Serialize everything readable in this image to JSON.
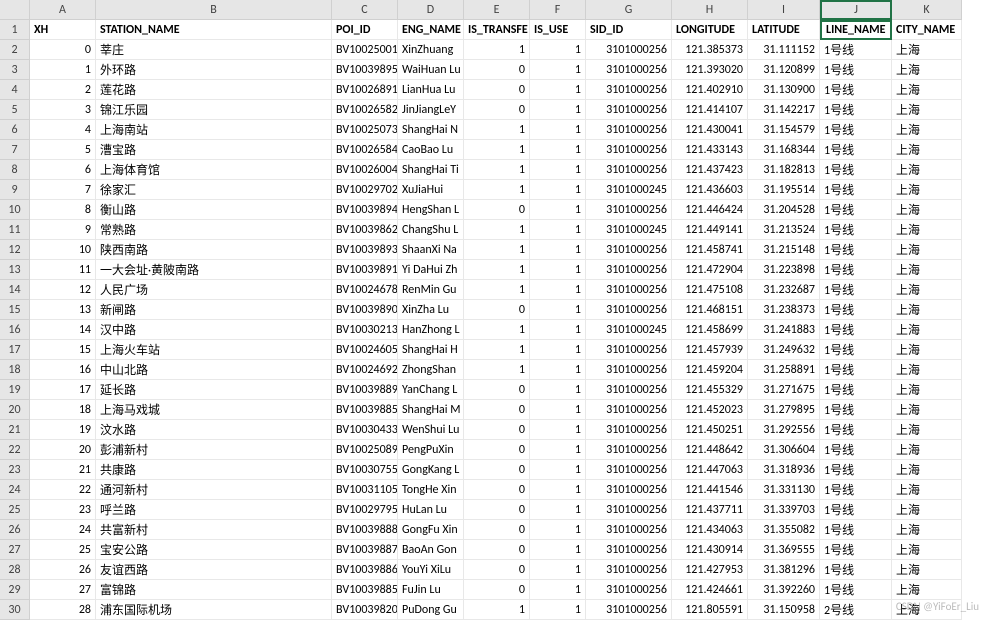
{
  "columns": [
    "A",
    "B",
    "C",
    "D",
    "E",
    "F",
    "G",
    "H",
    "I",
    "J",
    "K"
  ],
  "selectedCol": "J",
  "chart_data": {
    "type": "table",
    "headers": [
      "XH",
      "STATION_NAME",
      "POI_ID",
      "ENG_NAME",
      "IS_TRANSFER",
      "IS_USE",
      "SID_ID",
      "LONGITUDE",
      "LATITUDE",
      "LINE_NAME",
      "CITY_NAME"
    ],
    "headers_display": [
      "XH",
      "STATION_NAME",
      "POI_ID",
      "ENG_NAME",
      "IS_TRANSFE",
      "IS_USE",
      "SID_ID",
      "LONGITUDE",
      "LATITUDE",
      "LINE_NAME",
      "CITY_NAME"
    ],
    "rows": [
      [
        "0",
        "莘庄",
        "BV10025001",
        "XinZhuang",
        "1",
        "1",
        "3101000256",
        "121.385373",
        "31.111152",
        "1号线",
        "上海"
      ],
      [
        "1",
        "外环路",
        "BV10039895",
        "WaiHuan Lu",
        "0",
        "1",
        "3101000256",
        "121.393020",
        "31.120899",
        "1号线",
        "上海"
      ],
      [
        "2",
        "莲花路",
        "BV10026891",
        "LianHua Lu",
        "0",
        "1",
        "3101000256",
        "121.402910",
        "31.130900",
        "1号线",
        "上海"
      ],
      [
        "3",
        "锦江乐园",
        "BV10026582",
        "JinJiangLeY",
        "0",
        "1",
        "3101000256",
        "121.414107",
        "31.142217",
        "1号线",
        "上海"
      ],
      [
        "4",
        "上海南站",
        "BV10025073",
        "ShangHai N",
        "1",
        "1",
        "3101000256",
        "121.430041",
        "31.154579",
        "1号线",
        "上海"
      ],
      [
        "5",
        "漕宝路",
        "BV10026584",
        "CaoBao Lu",
        "1",
        "1",
        "3101000256",
        "121.433143",
        "31.168344",
        "1号线",
        "上海"
      ],
      [
        "6",
        "上海体育馆",
        "BV10026004",
        "ShangHai Ti",
        "1",
        "1",
        "3101000256",
        "121.437423",
        "31.182813",
        "1号线",
        "上海"
      ],
      [
        "7",
        "徐家汇",
        "BV10029702",
        "XuJiaHui",
        "1",
        "1",
        "3101000245",
        "121.436603",
        "31.195514",
        "1号线",
        "上海"
      ],
      [
        "8",
        "衡山路",
        "BV10039894",
        "HengShan L",
        "0",
        "1",
        "3101000256",
        "121.446424",
        "31.204528",
        "1号线",
        "上海"
      ],
      [
        "9",
        "常熟路",
        "BV10039862",
        "ChangShu L",
        "1",
        "1",
        "3101000245",
        "121.449141",
        "31.213524",
        "1号线",
        "上海"
      ],
      [
        "10",
        "陕西南路",
        "BV10039893",
        "ShaanXi Na",
        "1",
        "1",
        "3101000256",
        "121.458741",
        "31.215148",
        "1号线",
        "上海"
      ],
      [
        "11",
        "一大会址·黄陂南路",
        "BV10039891",
        "Yi DaHui Zh",
        "1",
        "1",
        "3101000256",
        "121.472904",
        "31.223898",
        "1号线",
        "上海"
      ],
      [
        "12",
        "人民广场",
        "BV10024678",
        "RenMin Gu",
        "1",
        "1",
        "3101000256",
        "121.475108",
        "31.232687",
        "1号线",
        "上海"
      ],
      [
        "13",
        "新闸路",
        "BV10039890",
        "XinZha Lu",
        "0",
        "1",
        "3101000256",
        "121.468151",
        "31.238373",
        "1号线",
        "上海"
      ],
      [
        "14",
        "汉中路",
        "BV10030213",
        "HanZhong L",
        "1",
        "1",
        "3101000245",
        "121.458699",
        "31.241883",
        "1号线",
        "上海"
      ],
      [
        "15",
        "上海火车站",
        "BV10024605",
        "ShangHai H",
        "1",
        "1",
        "3101000256",
        "121.457939",
        "31.249632",
        "1号线",
        "上海"
      ],
      [
        "16",
        "中山北路",
        "BV10024692",
        "ZhongShan",
        "1",
        "1",
        "3101000256",
        "121.459204",
        "31.258891",
        "1号线",
        "上海"
      ],
      [
        "17",
        "延长路",
        "BV10039889",
        "YanChang L",
        "0",
        "1",
        "3101000256",
        "121.455329",
        "31.271675",
        "1号线",
        "上海"
      ],
      [
        "18",
        "上海马戏城",
        "BV10039885",
        "ShangHai M",
        "0",
        "1",
        "3101000256",
        "121.452023",
        "31.279895",
        "1号线",
        "上海"
      ],
      [
        "19",
        "汶水路",
        "BV10030433",
        "WenShui Lu",
        "0",
        "1",
        "3101000256",
        "121.450251",
        "31.292556",
        "1号线",
        "上海"
      ],
      [
        "20",
        "彭浦新村",
        "BV10025089",
        "PengPuXin",
        "0",
        "1",
        "3101000256",
        "121.448642",
        "31.306604",
        "1号线",
        "上海"
      ],
      [
        "21",
        "共康路",
        "BV10030755",
        "GongKang L",
        "0",
        "1",
        "3101000256",
        "121.447063",
        "31.318936",
        "1号线",
        "上海"
      ],
      [
        "22",
        "通河新村",
        "BV10031105",
        "TongHe Xin",
        "0",
        "1",
        "3101000256",
        "121.441546",
        "31.331130",
        "1号线",
        "上海"
      ],
      [
        "23",
        "呼兰路",
        "BV10029795",
        "HuLan Lu",
        "0",
        "1",
        "3101000256",
        "121.437711",
        "31.339703",
        "1号线",
        "上海"
      ],
      [
        "24",
        "共富新村",
        "BV10039888",
        "GongFu Xin",
        "0",
        "1",
        "3101000256",
        "121.434063",
        "31.355082",
        "1号线",
        "上海"
      ],
      [
        "25",
        "宝安公路",
        "BV10039887",
        "BaoAn Gon",
        "0",
        "1",
        "3101000256",
        "121.430914",
        "31.369555",
        "1号线",
        "上海"
      ],
      [
        "26",
        "友谊西路",
        "BV10039886",
        "YouYi XiLu",
        "0",
        "1",
        "3101000256",
        "121.427953",
        "31.381296",
        "1号线",
        "上海"
      ],
      [
        "27",
        "富锦路",
        "BV10039885",
        "FuJin Lu",
        "0",
        "1",
        "3101000256",
        "121.424661",
        "31.392260",
        "1号线",
        "上海"
      ],
      [
        "28",
        "浦东国际机场",
        "BV10039820",
        "PuDong Gu",
        "1",
        "1",
        "3101000256",
        "121.805591",
        "31.150958",
        "2号线",
        "上海"
      ]
    ]
  },
  "watermark": "CSDN @YiFoEr_Liu"
}
